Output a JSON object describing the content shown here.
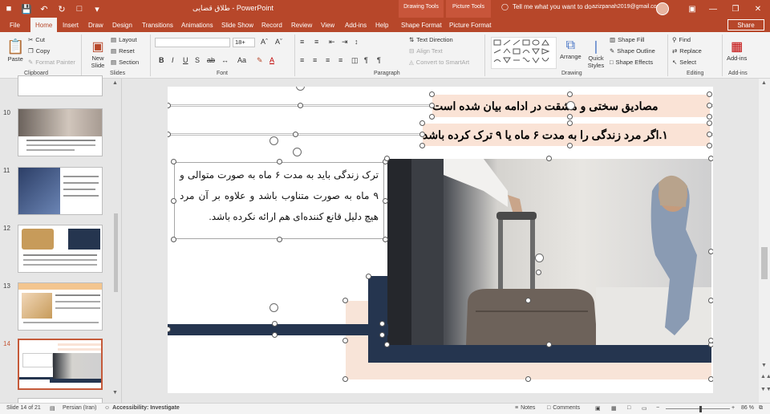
{
  "titlebar": {
    "doc_title": "طلاق قضایی  -  PowerPoint",
    "context_drawing": "Drawing Tools",
    "context_picture": "Picture Tools",
    "tell_me": "Tell me what you want to do",
    "account": "azizpanah2019@gmail.com"
  },
  "tabs": [
    "File",
    "Home",
    "Insert",
    "Draw",
    "Design",
    "Transitions",
    "Animations",
    "Slide Show",
    "Record",
    "Review",
    "View",
    "Add-ins",
    "Help",
    "Shape Format",
    "Picture Format"
  ],
  "share_label": "Share",
  "ribbon": {
    "clipboard": {
      "paste": "Paste",
      "cut": "Cut",
      "copy": "Copy",
      "format_painter": "Format Painter",
      "label": "Clipboard"
    },
    "slides": {
      "new_slide": "New Slide",
      "layout": "Layout",
      "reset": "Reset",
      "section": "Section",
      "label": "Slides"
    },
    "font": {
      "font_name": "",
      "font_size": "18+",
      "label": "Font"
    },
    "paragraph": {
      "text_direction": "Text Direction",
      "align_text": "Align Text",
      "convert_smartart": "Convert to SmartArt",
      "label": "Paragraph"
    },
    "drawing": {
      "arrange": "Arrange",
      "quick_styles": "Quick Styles",
      "shape_fill": "Shape Fill",
      "shape_outline": "Shape Outline",
      "shape_effects": "Shape Effects",
      "label": "Drawing"
    },
    "editing": {
      "find": "Find",
      "replace": "Replace",
      "select": "Select",
      "label": "Editing"
    },
    "addins": {
      "addins": "Add-ins",
      "label": "Add-ins"
    }
  },
  "thumbnails": [
    {
      "num": "10"
    },
    {
      "num": "11"
    },
    {
      "num": "12"
    },
    {
      "num": "13"
    },
    {
      "num": "14"
    }
  ],
  "slide": {
    "heading1": "مصادیق سختی و مشقت در ادامه بیان شده است",
    "heading2": "۱.اگر مرد زندگی را به مدت ۶ ماه یا ۹ ترک کرده باشد",
    "body": "ترک زندگی باید به مدت ۶ ماه به صورت متوالی و ۹ ماه به صورت متناوب باشد و علاوه بر آن مرد هیچ دلیل قانع کننده‌ای هم ارائه نکرده باشد."
  },
  "status": {
    "slide_info": "Slide 14 of 21",
    "language": "Persian (Iran)",
    "accessibility": "Accessibility: Investigate",
    "notes": "Notes",
    "comments": "Comments",
    "zoom": "86 %"
  },
  "colors": {
    "accent": "#b7472a",
    "navy": "#25354f",
    "peach": "#fae3d6"
  }
}
